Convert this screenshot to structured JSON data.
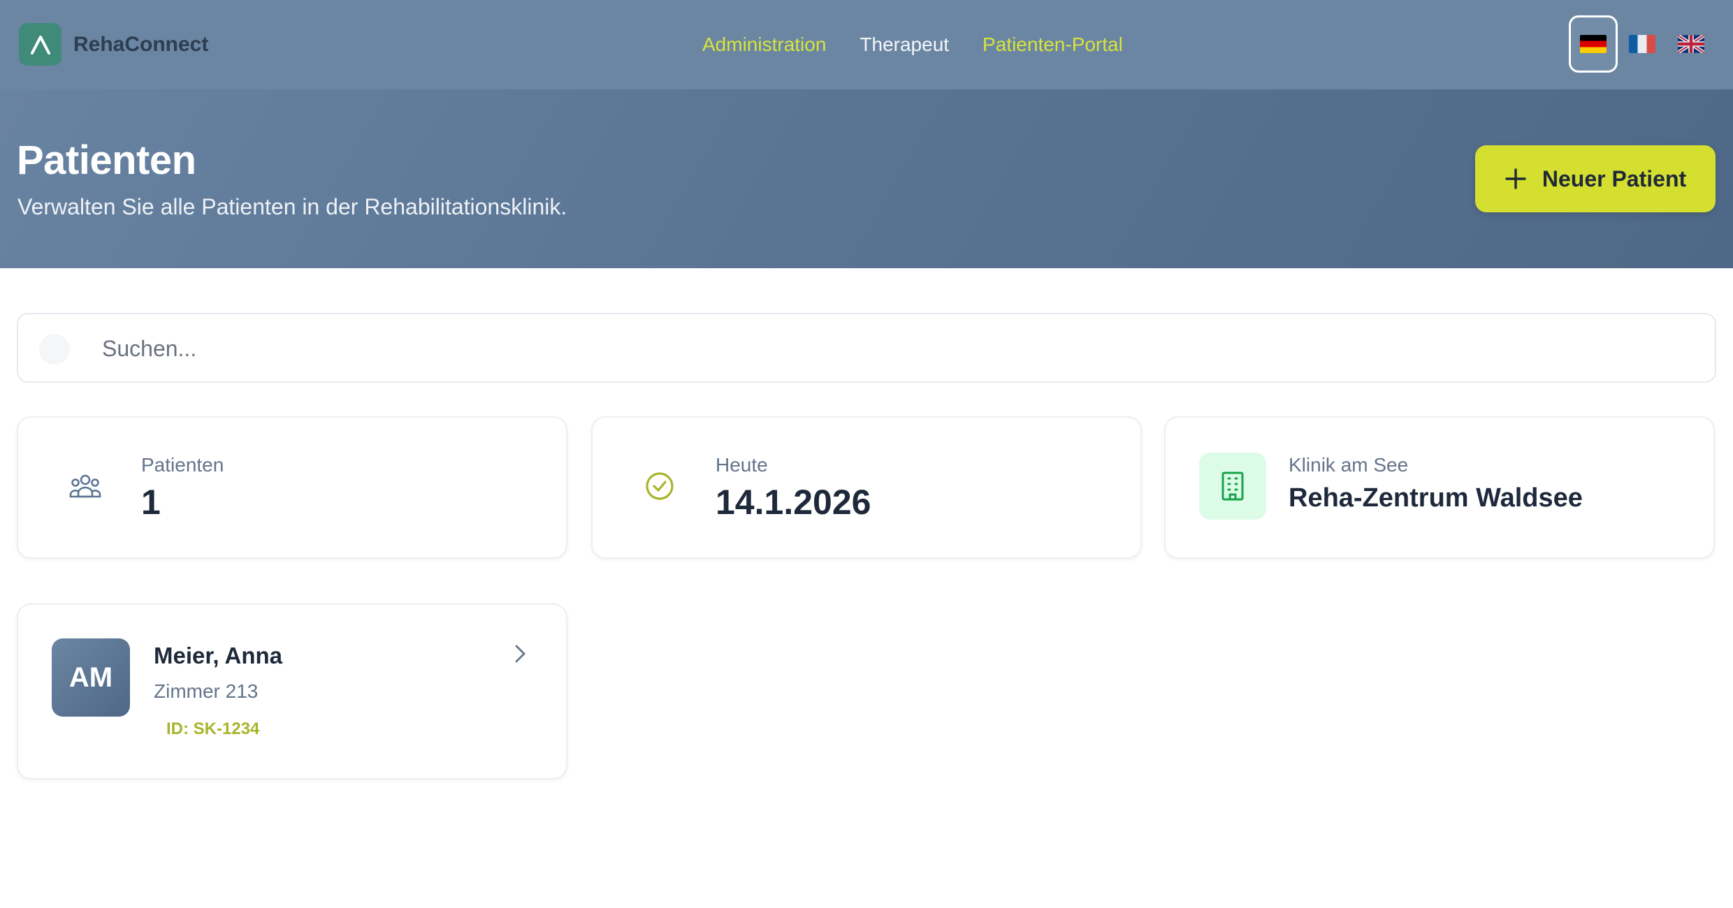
{
  "header": {
    "brand": "RehaConnect",
    "nav": [
      {
        "label": "Administration"
      },
      {
        "label": "Therapeut"
      },
      {
        "label": "Patienten-Portal"
      }
    ],
    "languages": [
      "de",
      "fr",
      "en"
    ],
    "active_language": "de"
  },
  "hero": {
    "title": "Patienten",
    "subtitle": "Verwalten Sie alle Patienten in der Rehabilitationsklinik.",
    "new_button_label": "Neuer Patient"
  },
  "search": {
    "placeholder": "Suchen...",
    "value": ""
  },
  "stats": [
    {
      "label": "Patienten",
      "value": "1",
      "icon": "users-icon"
    },
    {
      "label": "Heute",
      "value": "14.1.2026",
      "icon": "check-circle-icon"
    },
    {
      "label": "Klinik am See",
      "value": "Reha-Zentrum Waldsee",
      "icon": "building-icon"
    }
  ],
  "patients": [
    {
      "initials": "AM",
      "name": "Meier, Anna",
      "room": "Zimmer 213",
      "id": "ID: SK-1234"
    }
  ],
  "colors": {
    "nav_bg": "#6b86a3",
    "accent_yellow": "#d4df2f",
    "accent_text": "#d9e33a",
    "logo_green": "#3f8a78",
    "id_green": "#a7b52a"
  }
}
